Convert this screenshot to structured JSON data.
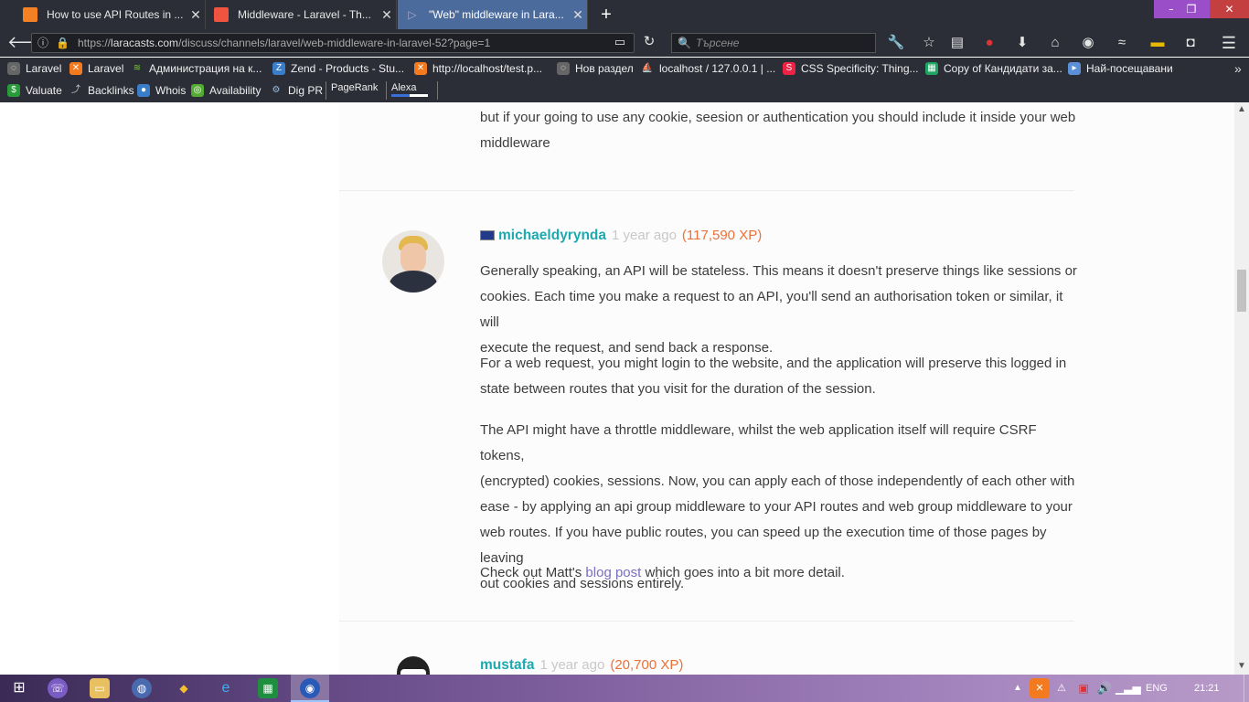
{
  "tabs": [
    {
      "title": "How to use API Routes in ...",
      "active": false
    },
    {
      "title": "Middleware - Laravel - Th...",
      "active": false
    },
    {
      "title": "\"Web\" middleware in Lara...",
      "active": true
    }
  ],
  "new_tab_label": "+",
  "address": {
    "prefix": "https://",
    "domain": "laracasts.com",
    "path": "/discuss/channels/laravel/web-middleware-in-laravel-52?page=1"
  },
  "search_placeholder": "Търсене",
  "bookmarks_row1": [
    "Laravel",
    "Laravel",
    "Администрация на к...",
    "Zend - Products - Stu...",
    "http://localhost/test.p...",
    "Нов раздел",
    "localhost / 127.0.0.1 | ...",
    "CSS Specificity: Thing...",
    "Copy of Кандидати за...",
    "Най-посещавани"
  ],
  "bookmarks_row2": [
    "Valuate",
    "Backlinks",
    "Whois",
    "Availability",
    "Dig PR",
    "PageRank",
    "Alexa"
  ],
  "prev_comment": {
    "line1": "but if your going to use any cookie, seesion or authentication you should include it inside your web",
    "line2": "middleware"
  },
  "comment1": {
    "username": "michaeldyrynda",
    "ago": "1 year ago",
    "xp": "(117,590 XP)",
    "p1": [
      "Generally speaking, an API will be stateless. This means it doesn't preserve things like sessions or",
      "cookies. Each time you make a request to an API, you'll send an authorisation token or similar, it will",
      "execute the request, and send back a response."
    ],
    "p2": [
      "For a web request, you might login to the website, and the application will preserve this logged in",
      "state between routes that you visit for the duration of the session."
    ],
    "p3": [
      "The API might have a throttle middleware, whilst the web application itself will require CSRF tokens,",
      "(encrypted) cookies, sessions. Now, you can apply each of those independently of each other with",
      "ease - by applying an api group middleware to your API routes and web group middleware to your",
      "web routes. If you have public routes, you can speed up the execution time of those pages by leaving",
      "out cookies and sessions entirely."
    ],
    "p4_before": "Check out Matt's ",
    "p4_link": "blog post",
    "p4_after": " which goes into a bit more detail."
  },
  "comment2": {
    "username": "mustafa",
    "ago": "1 year ago",
    "xp": "(20,700 XP)"
  },
  "taskbar": {
    "lang": "ENG",
    "time": "21:21"
  },
  "colors": {
    "accent_teal": "#1caab0",
    "xp_orange": "#e8723a",
    "link_purple": "#7a6fc0",
    "chrome_dark": "#2b2e36",
    "active_tab": "#4b6b9c"
  }
}
